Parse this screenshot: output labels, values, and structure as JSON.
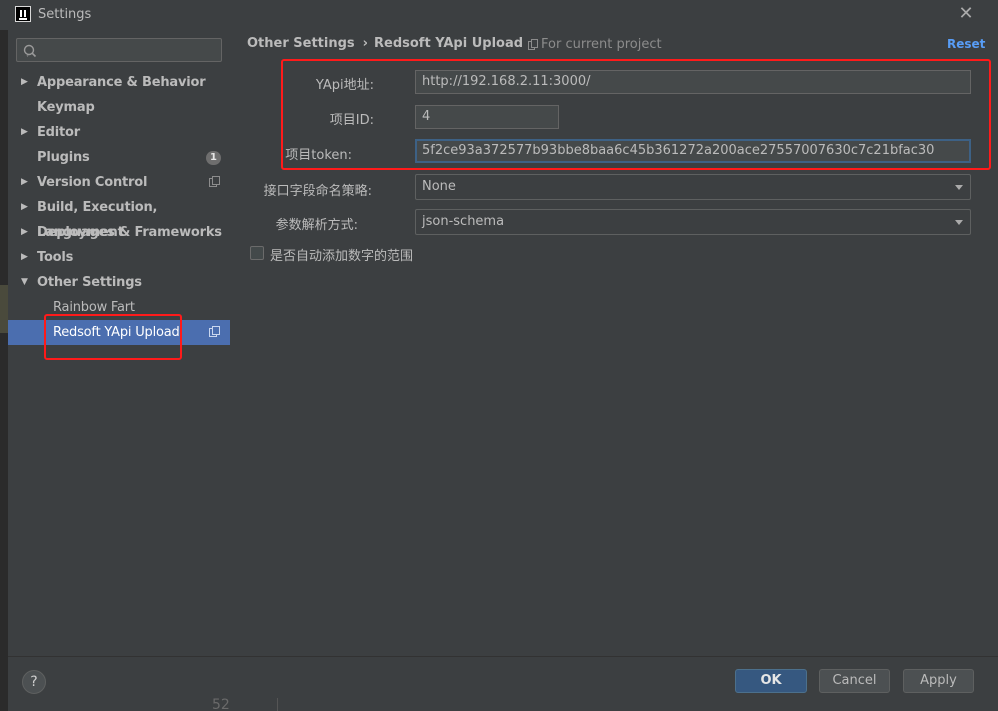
{
  "window": {
    "title": "Settings",
    "close_glyph": "✕"
  },
  "search": {
    "placeholder": ""
  },
  "sidebar": {
    "items": [
      {
        "label": "Appearance & Behavior",
        "arrow": "▶"
      },
      {
        "label": "Keymap"
      },
      {
        "label": "Editor",
        "arrow": "▶"
      },
      {
        "label": "Plugins",
        "badge": "1"
      },
      {
        "label": "Version Control",
        "arrow": "▶"
      },
      {
        "label": "Build, Execution, Deployment",
        "arrow": "▶"
      },
      {
        "label": "Languages & Frameworks",
        "arrow": "▶"
      },
      {
        "label": "Tools",
        "arrow": "▶"
      },
      {
        "label": "Other Settings",
        "arrow": "▼"
      },
      {
        "label": "Rainbow Fart"
      },
      {
        "label": "Redsoft YApi Upload",
        "selected": true
      }
    ]
  },
  "header": {
    "breadcrumb_parent": "Other Settings",
    "breadcrumb_sep": "›",
    "breadcrumb_current": "Redsoft YApi Upload",
    "scope": "For current project",
    "reset": "Reset"
  },
  "form": {
    "yapi_url_label": "YApi地址:",
    "yapi_url_value": "http://192.168.2.11:3000/",
    "project_id_label": "项目ID:",
    "project_id_value": "4",
    "project_token_label": "项目token:",
    "project_token_value": "5f2ce93a372577b93bbe8baa6c45b361272a200ace27557007630c7c21bfac30",
    "field_naming_label": "接口字段命名策略:",
    "field_naming_value": "None",
    "parse_mode_label": "参数解析方式:",
    "parse_mode_value": "json-schema",
    "auto_range_label": "是否自动添加数字的范围",
    "auto_range_checked": false
  },
  "footer": {
    "help": "?",
    "ok": "OK",
    "cancel": "Cancel",
    "apply": "Apply"
  },
  "background": {
    "line_number": "52"
  },
  "colors": {
    "accent": "#4b6eaf",
    "link": "#589df6",
    "highlight_box": "#ff1a1a",
    "primary_button": "#365880"
  }
}
